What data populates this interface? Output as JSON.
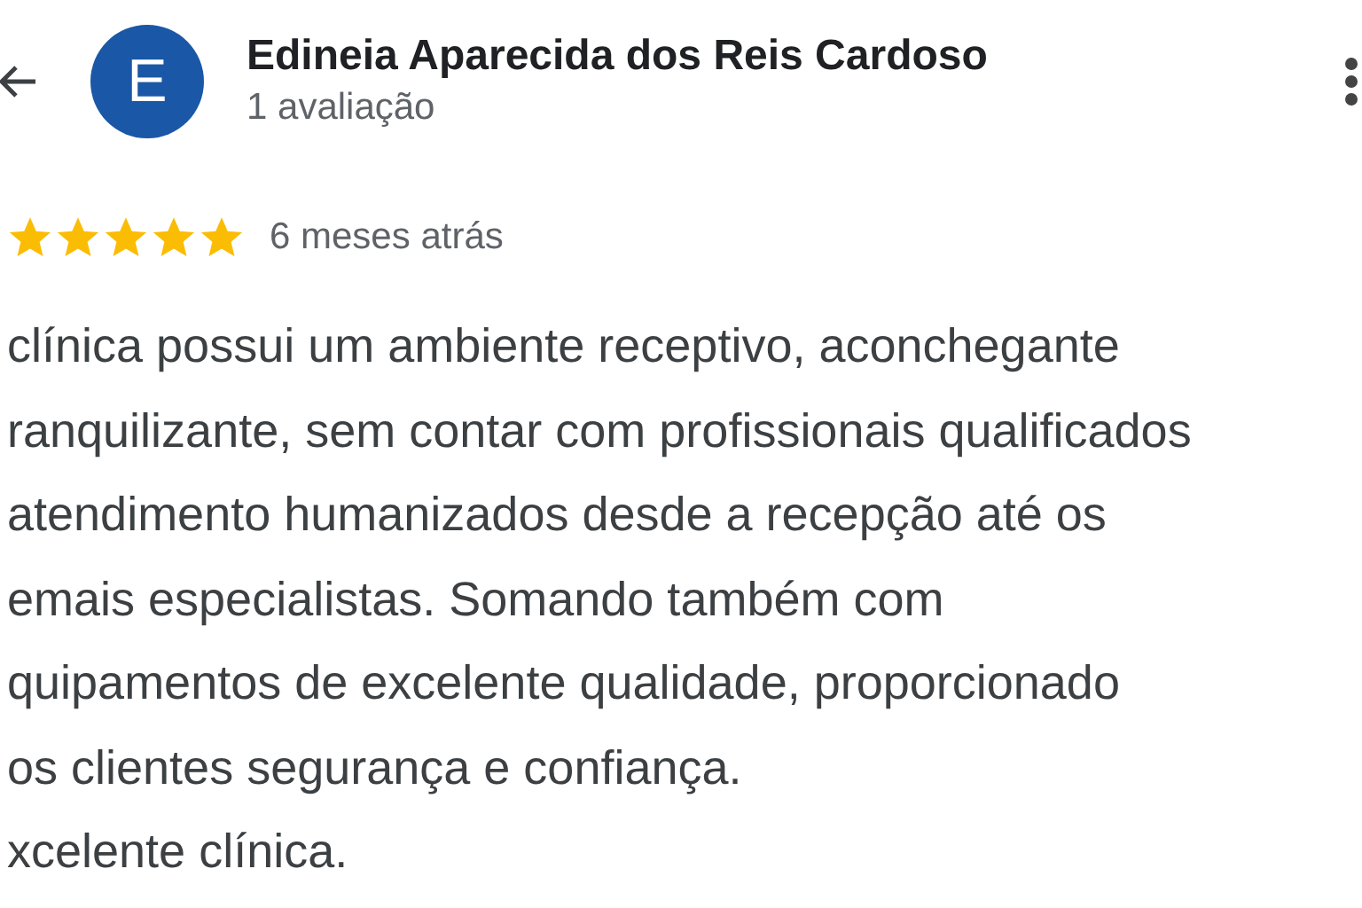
{
  "reviewer": {
    "avatar_letter": "E",
    "name": "Edineia Aparecida dos Reis Cardoso",
    "review_count": "1 avaliação"
  },
  "review": {
    "stars": 5,
    "time": "6 meses atrás",
    "lines": [
      "clínica possui um ambiente receptivo, aconchegante",
      "ranquilizante, sem contar com profissionais qualificados",
      "atendimento humanizados desde a recepção até os",
      "emais especialistas. Somando também com",
      "quipamentos de excelente qualidade, proporcionado",
      "os clientes segurança e confiança.",
      "xcelente clínica."
    ]
  }
}
